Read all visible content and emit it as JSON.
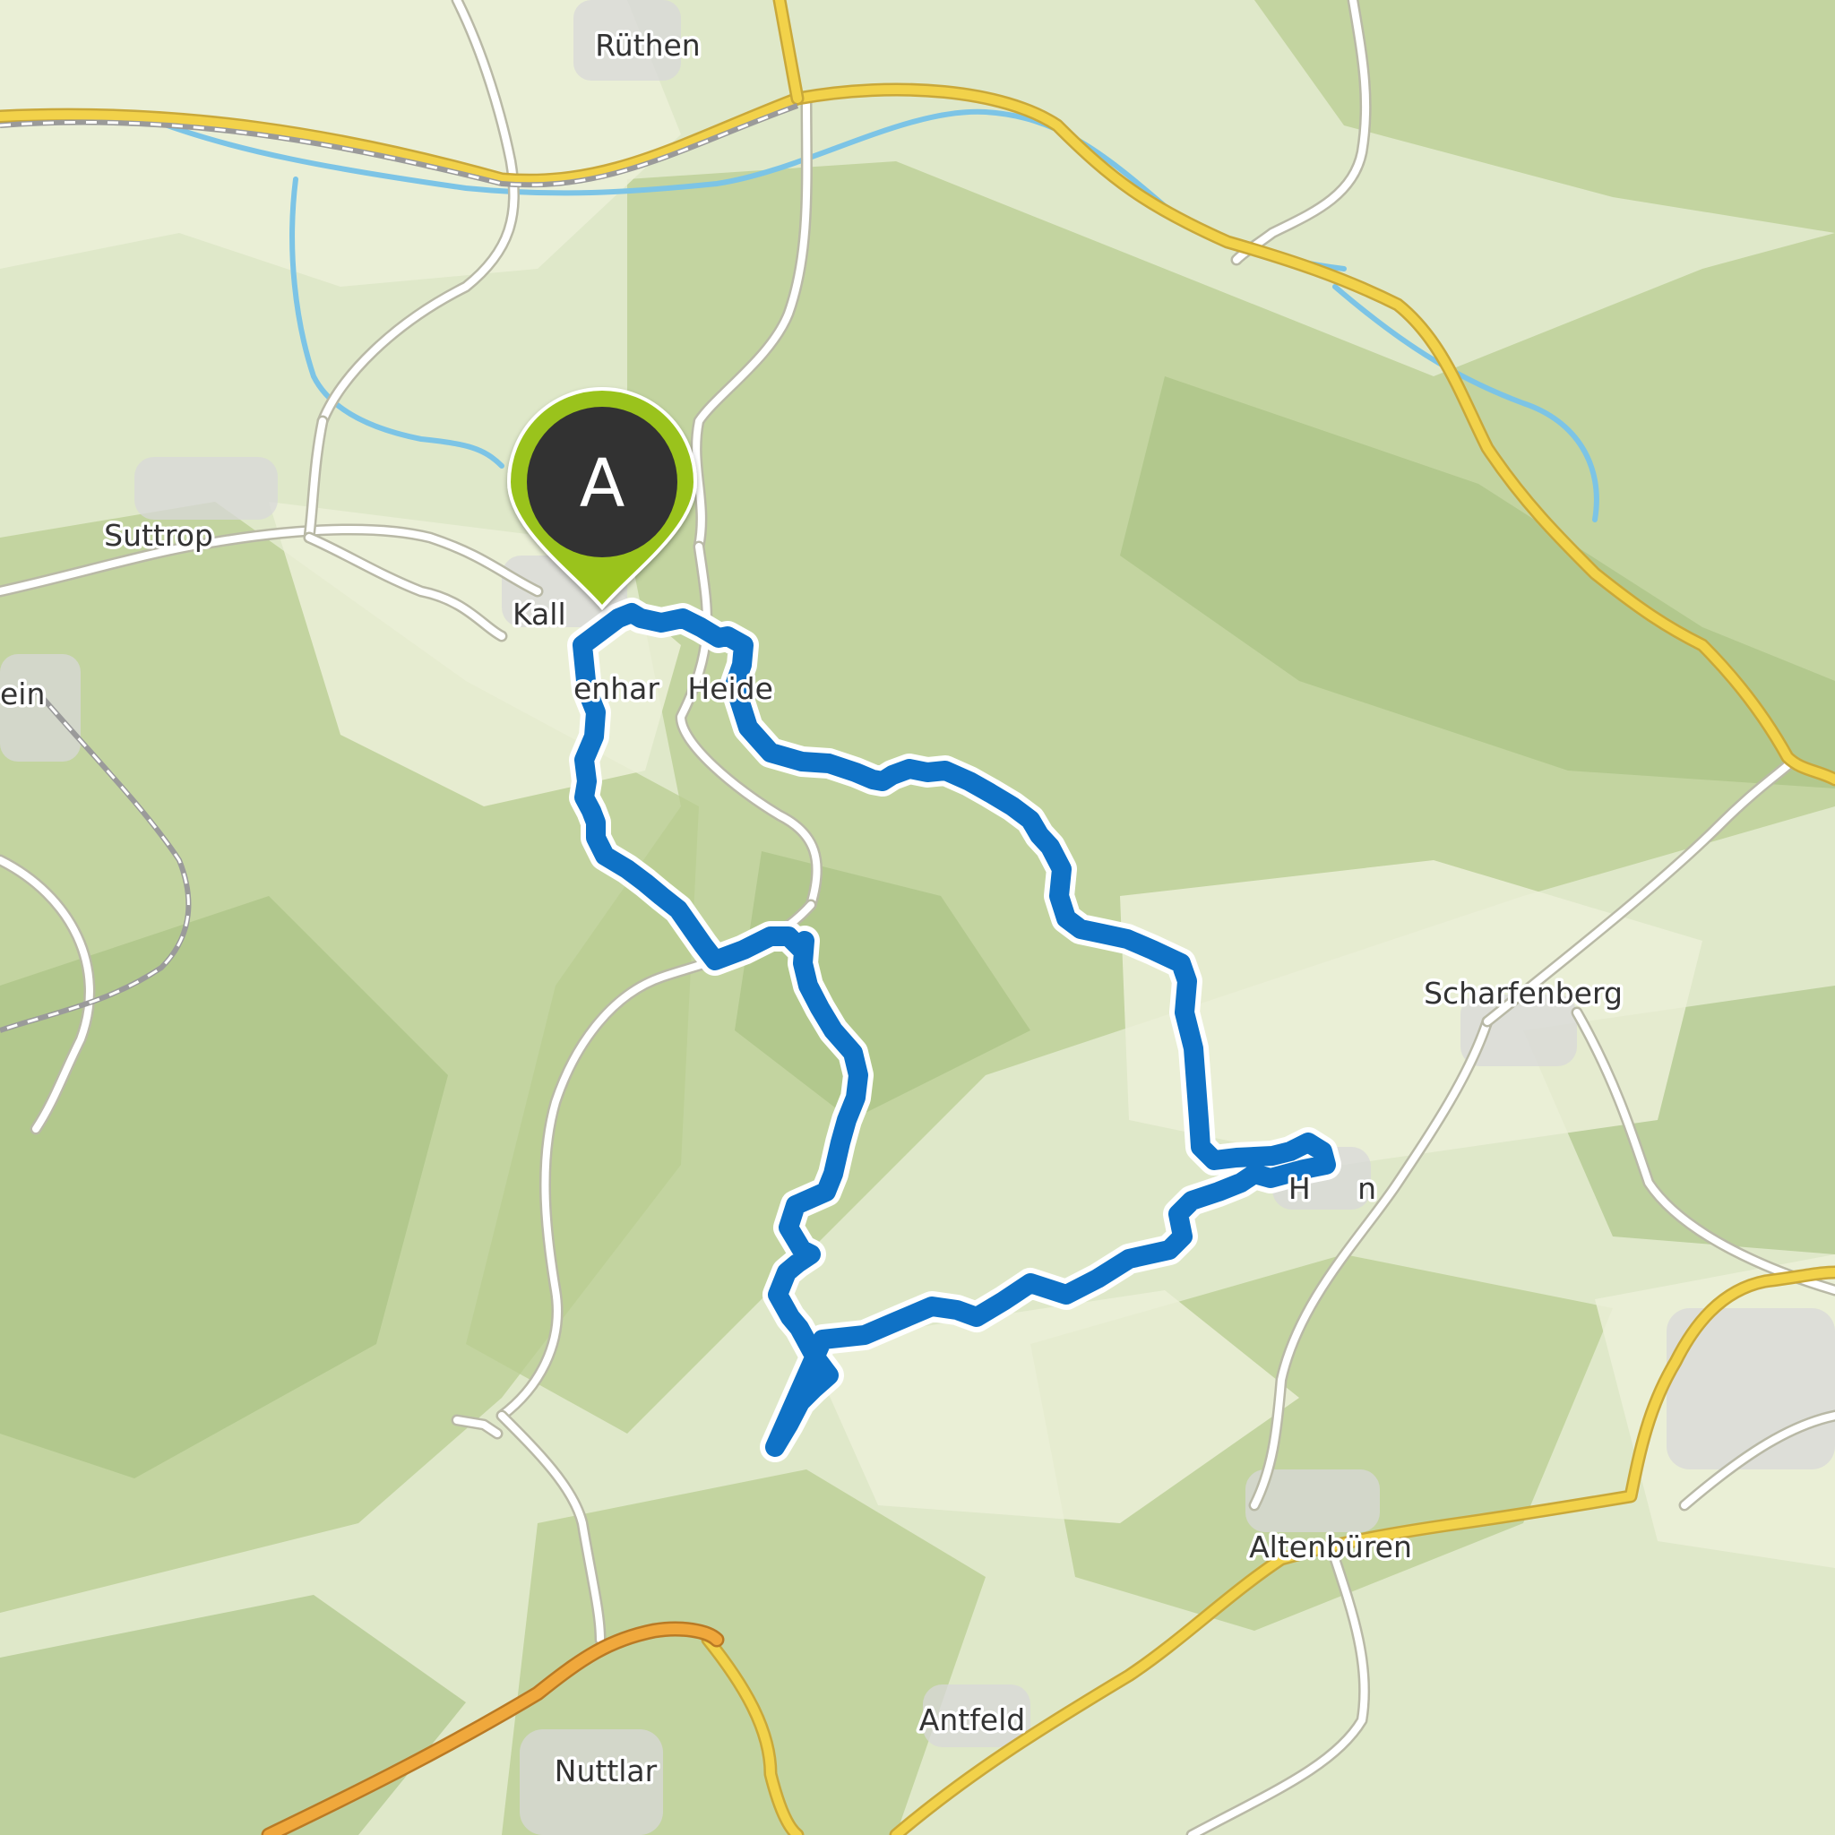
{
  "map": {
    "start_marker": {
      "letter": "A",
      "color": "#9ac31c",
      "inner_color": "#333333"
    },
    "route_color": "#0f72c6",
    "colors": {
      "terrain_base": "#dfe8c9",
      "forest": "#b9ce92",
      "forest_dark": "#a7bf80",
      "field": "#ecf0d8",
      "water": "#7cc4e6",
      "major_road": "#f2d24a",
      "major_road_casing": "#c9a83a",
      "motorway": "#f0a83c",
      "minor_road": "#ffffff",
      "minor_road_casing": "#b9b9a6",
      "town": "#d8d8d8"
    },
    "places": [
      {
        "id": "ruethen",
        "text": "Rüthen"
      },
      {
        "id": "suttrop",
        "text": "Suttrop"
      },
      {
        "id": "kallenhardt",
        "text": "Kall"
      },
      {
        "id": "heide",
        "text": "enhar   Heide"
      },
      {
        "id": "stein",
        "text": "ein"
      },
      {
        "id": "scharfenberg",
        "text": "Scharfenberg"
      },
      {
        "id": "hemmern",
        "text": "H     n"
      },
      {
        "id": "altenbueren",
        "text": "Altenbüren"
      },
      {
        "id": "antfeld",
        "text": "Antfeld"
      },
      {
        "id": "nuttlar",
        "text": "Nuttlar"
      }
    ]
  }
}
